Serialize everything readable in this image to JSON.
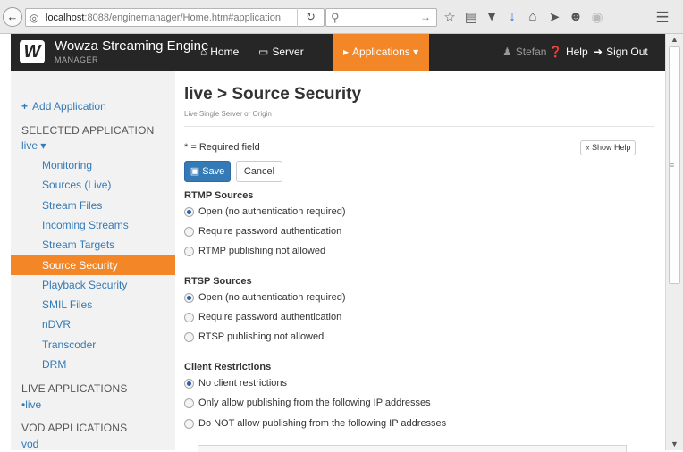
{
  "browser": {
    "url_host": "localhost",
    "url_rest": ":8088/enginemanager/Home.htm#application",
    "search_placeholder": "",
    "icons": [
      "back-icon",
      "globe-icon",
      "reload-icon",
      "search-icon",
      "star-icon",
      "reader-icon",
      "pocket-icon",
      "download-icon",
      "home-icon",
      "send-icon",
      "chat-icon",
      "addon-icon",
      "menu-icon"
    ]
  },
  "header": {
    "brand": "Wowza Streaming Engine",
    "brand_sub": "MANAGER",
    "nav": {
      "home": "Home",
      "server": "Server",
      "applications": "Applications",
      "user": "Stefan",
      "help": "Help",
      "signout": "Sign Out"
    },
    "accent_color": "#f38627"
  },
  "sidebar": {
    "add": "Add Application",
    "selected_heading": "SELECTED APPLICATION",
    "selected_app": "live",
    "items": [
      {
        "label": "Monitoring"
      },
      {
        "label": "Sources (Live)"
      },
      {
        "label": "Stream Files"
      },
      {
        "label": "Incoming Streams"
      },
      {
        "label": "Stream Targets"
      },
      {
        "label": "Source Security"
      },
      {
        "label": "Playback Security"
      },
      {
        "label": "SMIL Files"
      },
      {
        "label": "nDVR"
      },
      {
        "label": "Transcoder"
      },
      {
        "label": "DRM"
      }
    ],
    "active_index": 5,
    "live_heading": "LIVE APPLICATIONS",
    "live_apps": [
      "live"
    ],
    "vod_heading": "VOD APPLICATIONS",
    "vod_apps": [
      "vod"
    ]
  },
  "main": {
    "title": "live > Source Security",
    "subtitle": "Live Single Server or Origin",
    "required_note": "* = Required field",
    "show_help": "« Show Help",
    "save": "Save",
    "cancel": "Cancel",
    "sections": [
      {
        "heading": "RTMP Sources",
        "options": [
          "Open (no authentication required)",
          "Require password authentication",
          "RTMP publishing not allowed"
        ],
        "selected": 0
      },
      {
        "heading": "RTSP Sources",
        "options": [
          "Open (no authentication required)",
          "Require password authentication",
          "RTSP publishing not allowed"
        ],
        "selected": 0
      },
      {
        "heading": "Client Restrictions",
        "options": [
          "No client restrictions",
          "Only allow publishing from the following IP addresses",
          "Do NOT allow publishing from the following IP addresses"
        ],
        "selected": 0
      }
    ]
  }
}
